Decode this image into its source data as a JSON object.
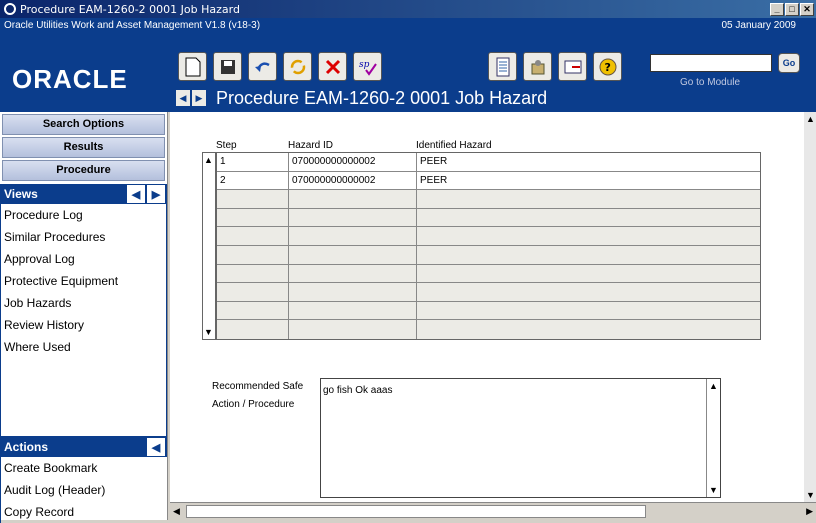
{
  "window": {
    "title": "Procedure EAM-1260-2 0001 Job Hazard",
    "controls": [
      "_",
      "□",
      "✕"
    ]
  },
  "app": {
    "name": "Oracle Utilities Work and Asset Management V1.8 (v18-3)",
    "date": "05 January  2009",
    "logo": "ORACLE"
  },
  "toolbar": {
    "buttons": [
      "new-icon",
      "save-icon",
      "undo-icon",
      "refresh-icon",
      "delete-icon",
      "spell-check-icon",
      "report-icon",
      "tools-icon",
      "mail-icon",
      "help-icon"
    ]
  },
  "header": {
    "page_title": "Procedure EAM-1260-2 0001 Job Hazard",
    "goto_label": "Go to Module",
    "go_button": "Go",
    "goto_value": ""
  },
  "sidebar": {
    "buttons": [
      "Search Options",
      "Results",
      "Procedure"
    ],
    "views_label": "Views",
    "views": [
      "Procedure Log",
      "Similar Procedures",
      "Approval Log",
      "Protective Equipment",
      "Job Hazards",
      "Review History",
      "Where Used"
    ],
    "actions_label": "Actions",
    "actions": [
      "Create Bookmark",
      "Audit Log (Header)",
      "Copy Record"
    ]
  },
  "grid": {
    "headers": [
      "Step",
      "Hazard ID",
      "Identified Hazard"
    ],
    "rows": [
      {
        "step": "1",
        "hazard_id": "070000000000002",
        "hazard": "PEER"
      },
      {
        "step": "2",
        "hazard_id": "070000000000002",
        "hazard": "PEER"
      }
    ],
    "empty_rows": 8
  },
  "recommended": {
    "label_line1": "Recommended Safe",
    "label_line2": "Action / Procedure",
    "value": "go fish Ok aaas"
  }
}
